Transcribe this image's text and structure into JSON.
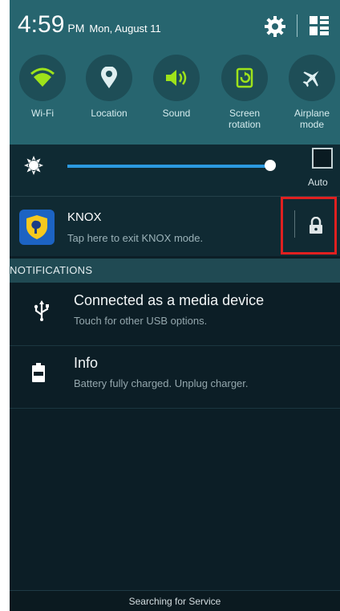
{
  "status": {
    "time": "4:59",
    "ampm": "PM",
    "date": "Mon, August 11"
  },
  "quick_settings": [
    {
      "label": "Wi-Fi",
      "icon": "wifi-icon"
    },
    {
      "label": "Location",
      "icon": "location-icon"
    },
    {
      "label": "Sound",
      "icon": "sound-icon"
    },
    {
      "label": "Screen\nrotation",
      "icon": "screen-rotation-icon"
    },
    {
      "label": "Airplane\nmode",
      "icon": "airplane-icon"
    }
  ],
  "brightness": {
    "level": 0.95,
    "auto_label": "Auto"
  },
  "knox": {
    "title": "KNOX",
    "subtitle": "Tap here to exit KNOX mode."
  },
  "notifications": {
    "header": "NOTIFICATIONS",
    "items": [
      {
        "title": "Connected as a media device",
        "subtitle": "Touch for other USB options.",
        "icon": "usb-icon"
      },
      {
        "title": "Info",
        "subtitle": "Battery fully charged. Unplug charger.",
        "icon": "battery-icon"
      }
    ]
  },
  "footer": {
    "text": "Searching for Service"
  },
  "colors": {
    "panel_bg": "#27656f",
    "accent_green": "#9ee31a",
    "slider_blue": "#2b9ae0",
    "highlight_red": "#e02020",
    "knox_blue": "#1c63c3",
    "knox_yellow": "#f7c91e"
  }
}
